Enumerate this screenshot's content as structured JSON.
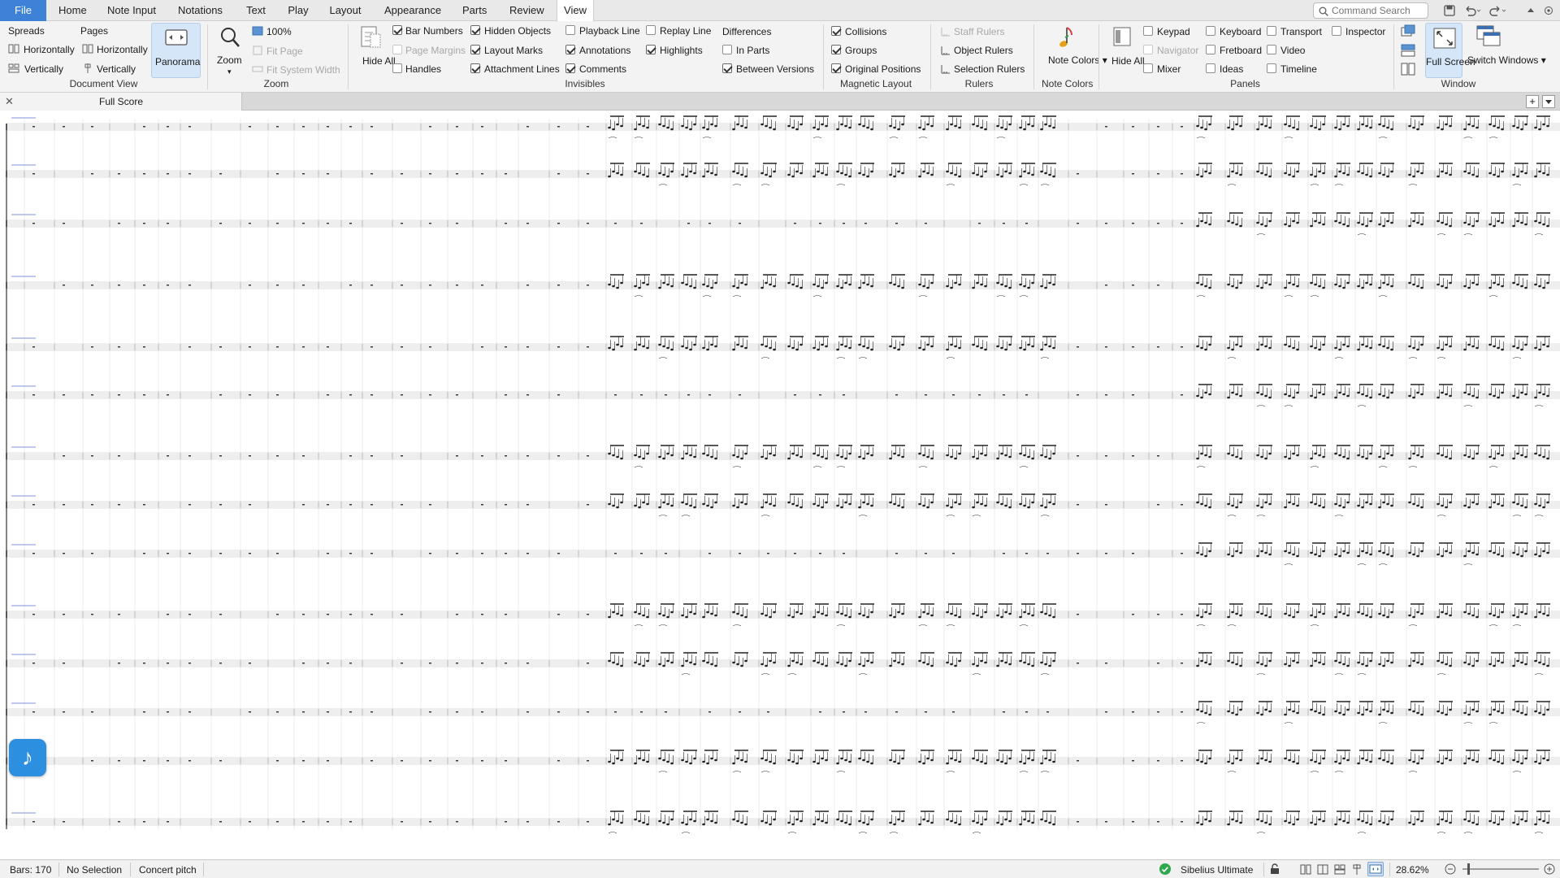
{
  "tabs": {
    "file": "File",
    "items": [
      "Home",
      "Note Input",
      "Notations",
      "Text",
      "Play",
      "Layout",
      "Appearance",
      "Parts",
      "Review",
      "View"
    ],
    "active": "View"
  },
  "command_search": {
    "placeholder": "Command Search"
  },
  "ribbon": {
    "document_view": {
      "title": "Document View",
      "spreads_label": "Spreads",
      "pages_label": "Pages",
      "spreads_horizontally": "Horizontally",
      "spreads_vertically": "Vertically",
      "pages_horizontally": "Horizontally",
      "pages_vertically": "Vertically",
      "panorama": "Panorama"
    },
    "zoom": {
      "title": "Zoom",
      "zoom_button": "Zoom",
      "percent_100": "100%",
      "fit_page": "Fit Page",
      "fit_system_width": "Fit System Width"
    },
    "invisibles": {
      "title": "Invisibles",
      "hide_all": "Hide All",
      "items": [
        {
          "label": "Bar Numbers",
          "checked": true,
          "enabled": true
        },
        {
          "label": "Page Margins",
          "checked": false,
          "enabled": false
        },
        {
          "label": "Handles",
          "checked": false,
          "enabled": true
        },
        {
          "label": "Hidden Objects",
          "checked": true,
          "enabled": true
        },
        {
          "label": "Layout Marks",
          "checked": true,
          "enabled": true
        },
        {
          "label": "Attachment Lines",
          "checked": true,
          "enabled": true
        },
        {
          "label": "Playback Line",
          "checked": false,
          "enabled": true
        },
        {
          "label": "Annotations",
          "checked": true,
          "enabled": true
        },
        {
          "label": "Comments",
          "checked": true,
          "enabled": true
        },
        {
          "label": "Replay Line",
          "checked": false,
          "enabled": true
        },
        {
          "label": "Highlights",
          "checked": true,
          "enabled": true
        }
      ],
      "differences_label": "Differences",
      "in_parts": {
        "label": "In Parts",
        "checked": false
      },
      "between_versions": {
        "label": "Between Versions",
        "checked": true
      }
    },
    "magnetic_layout": {
      "title": "Magnetic Layout",
      "items": [
        {
          "label": "Collisions",
          "checked": true
        },
        {
          "label": "Groups",
          "checked": true
        },
        {
          "label": "Original Positions",
          "checked": true
        }
      ]
    },
    "rulers": {
      "title": "Rulers",
      "staff_rulers": "Staff Rulers",
      "object_rulers": "Object Rulers",
      "selection_rulers": "Selection Rulers"
    },
    "note_colors": {
      "title": "Note Colors",
      "button": "Note Colors"
    },
    "panels": {
      "title": "Panels",
      "hide_all": "Hide All",
      "items": [
        {
          "label": "Keypad",
          "checked": false,
          "enabled": true
        },
        {
          "label": "Navigator",
          "checked": false,
          "enabled": false
        },
        {
          "label": "Mixer",
          "checked": false,
          "enabled": true
        },
        {
          "label": "Keyboard",
          "checked": false,
          "enabled": true
        },
        {
          "label": "Fretboard",
          "checked": false,
          "enabled": true
        },
        {
          "label": "Ideas",
          "checked": false,
          "enabled": true
        },
        {
          "label": "Transport",
          "checked": false,
          "enabled": true
        },
        {
          "label": "Video",
          "checked": false,
          "enabled": true
        },
        {
          "label": "Timeline",
          "checked": false,
          "enabled": true
        },
        {
          "label": "Inspector",
          "checked": false,
          "enabled": true
        }
      ]
    },
    "window": {
      "title": "Window",
      "full_screen": "Full Screen",
      "switch_windows": "Switch Windows"
    }
  },
  "document_tab": {
    "title": "Full Score"
  },
  "status": {
    "bars": "Bars: 170",
    "selection": "No Selection",
    "pitch": "Concert pitch",
    "edition": "Sibelius Ultimate",
    "zoom": "28.62%"
  },
  "colors": {
    "accent": "#3d82d6",
    "fab": "#2c8fdf",
    "annotation": "#5a6bd8"
  }
}
